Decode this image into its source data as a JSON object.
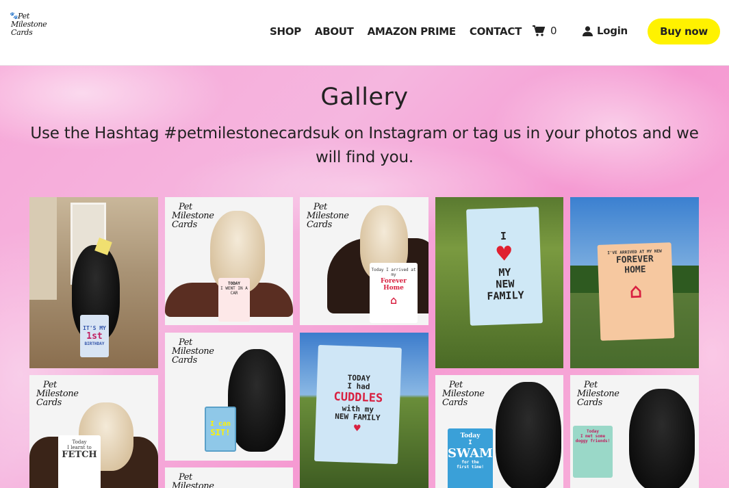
{
  "header": {
    "logo_lines": [
      "Pet",
      "Milestone",
      "Cards"
    ],
    "nav": [
      "SHOP",
      "ABOUT",
      "AMAZON PRIME",
      "CONTACT"
    ],
    "cart_count": "0",
    "login_label": "Login",
    "buy_label": "Buy now"
  },
  "hero": {
    "title": "Gallery",
    "subtitle": "Use the Hashtag #petmilestonecardsuk on Instagram or tag us in your photos and we will find you."
  },
  "gallery": {
    "watermark": [
      "Pet",
      "Milestone",
      "Cards"
    ],
    "cards": {
      "c1": [
        "IT'S MY",
        "1st",
        "BIRTHDAY"
      ],
      "c2": [
        "TODAY",
        "I WENT IN A CAR"
      ],
      "c3": [
        "Today I arrived at my",
        "Forever Home"
      ],
      "c4": [
        "I",
        "MY",
        "NEW",
        "FAMILY"
      ],
      "c5": [
        "I'VE ARRIVED AT MY NEW",
        "FOREVER",
        "HOME"
      ],
      "c6": [
        "Today",
        "I learnt to",
        "FETCH"
      ],
      "c7": [
        "I can",
        "SIT!"
      ],
      "c8": [
        "TODAY",
        "I had",
        "CUDDLES",
        "with my",
        "NEW FAMILY"
      ],
      "c9": [
        "Today",
        "I",
        "SWAM",
        "for the",
        "first time!"
      ],
      "c10": [
        "Today",
        "I met some",
        "doggy friends!"
      ]
    }
  },
  "colors": {
    "accent_yellow": "#fff200",
    "hero_pink": "#f5b6df",
    "card_red": "#e02030"
  }
}
